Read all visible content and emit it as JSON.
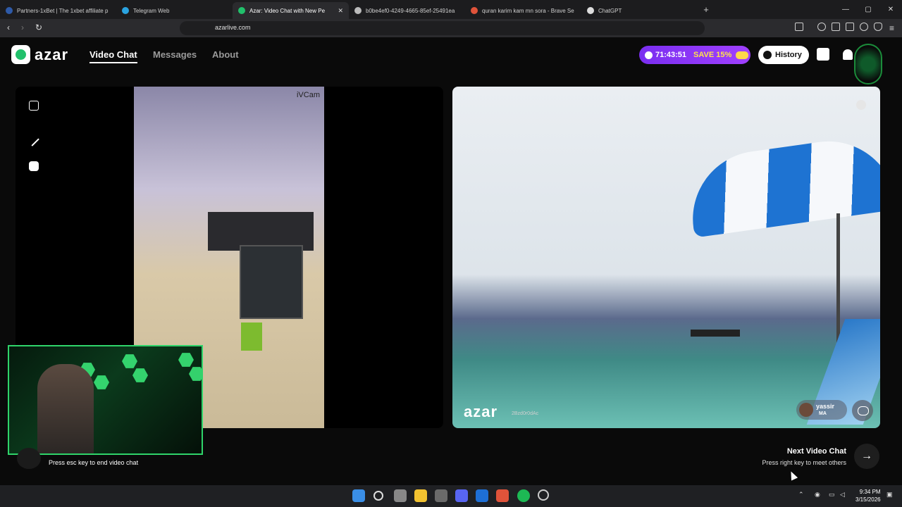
{
  "browser": {
    "tabs": [
      {
        "label": "Partners-1xBet | The 1xbet affiliate p",
        "fav_color": "#2e5aa8"
      },
      {
        "label": "Telegram Web",
        "fav_color": "#2aa3e0"
      },
      {
        "label": "Azar: Video Chat with New Pe",
        "fav_color": "#21c06b",
        "active": true
      },
      {
        "label": "b0be4ef0-4249-4665-85ef-25491ea",
        "fav_color": "#bbbbbb"
      },
      {
        "label": "quran karim kam mn sora - Brave Se",
        "fav_color": "#e0533a"
      },
      {
        "label": "ChatGPT",
        "fav_color": "#dddddd"
      }
    ],
    "url": "azarlive.com"
  },
  "header": {
    "logo_text": "azar",
    "nav": {
      "video_chat": "Video Chat",
      "messages": "Messages",
      "about": "About"
    },
    "timer": "71:43:51",
    "save_text": "SAVE 15%",
    "history_label": "History"
  },
  "left_panel": {
    "cam_watermark": "iVCam"
  },
  "right_panel": {
    "watermark": "azar",
    "watermark_code": "2Bzd0r0dAc",
    "user_name": "yassir",
    "user_country": "MA"
  },
  "footer": {
    "esc_hint": "Press esc key to end video chat",
    "next_title": "Next Video Chat",
    "next_hint": "Press right key to meet others",
    "next_arrow": "→"
  },
  "taskbar": {
    "time": "9:34 PM",
    "date": "3/15/2026"
  },
  "colors": {
    "accent": "#21c06b",
    "timer_gradient_start": "#7a2ef0",
    "save_yellow": "#ffe34a",
    "pip_border": "#2fd46a"
  }
}
